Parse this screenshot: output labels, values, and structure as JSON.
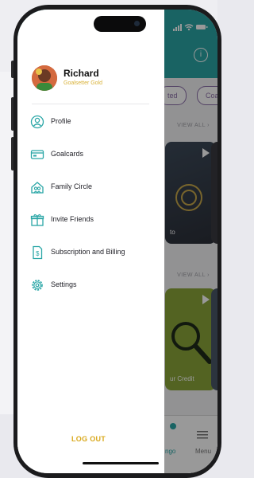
{
  "status_bar": {
    "icons": "signal-icon wifi-icon battery-icon"
  },
  "background_app": {
    "chips": [
      "ted",
      "Coa"
    ],
    "view_all_label": "VIEW ALL",
    "card_captions": [
      "to",
      "ur Credit"
    ],
    "tabs": [
      {
        "label": "ngo",
        "icon": "tab-active-icon"
      },
      {
        "label": "Menu",
        "icon": "menu-icon"
      }
    ],
    "header_color": "#2aa6a6",
    "accent_color": "#8b6ea8"
  },
  "drawer": {
    "user": {
      "name": "Richard",
      "tier": "Goalsetter Gold"
    },
    "menu": [
      {
        "label": "Profile",
        "icon": "profile-icon"
      },
      {
        "label": "Goalcards",
        "icon": "goalcards-icon"
      },
      {
        "label": "Family Circle",
        "icon": "family-circle-icon"
      },
      {
        "label": "Invite Friends",
        "icon": "gift-icon"
      },
      {
        "label": "Subscription and Billing",
        "icon": "billing-icon"
      },
      {
        "label": "Settings",
        "icon": "settings-icon"
      }
    ],
    "logout_label": "LOG OUT",
    "icon_color": "#2aa6a6",
    "logout_color": "#d9a81b"
  }
}
